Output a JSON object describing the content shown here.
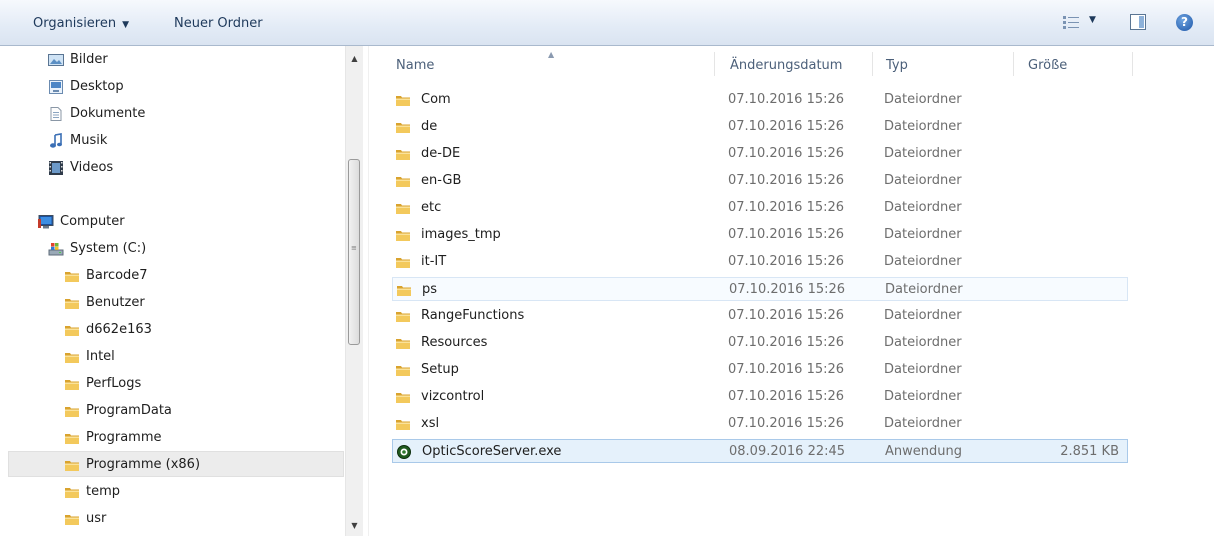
{
  "toolbar": {
    "organize_label": "Organisieren",
    "new_folder_label": "Neuer Ordner",
    "help_glyph": "?"
  },
  "nav": {
    "items": [
      {
        "label": "Bilder",
        "icon": "pictures-icon"
      },
      {
        "label": "Desktop",
        "icon": "desktop-icon"
      },
      {
        "label": "Dokumente",
        "icon": "documents-icon"
      },
      {
        "label": "Musik",
        "icon": "music-icon"
      },
      {
        "label": "Videos",
        "icon": "videos-icon"
      },
      {
        "label": "Computer",
        "icon": "computer-icon"
      },
      {
        "label": "System (C:)",
        "icon": "drive-icon"
      },
      {
        "label": "Barcode7",
        "icon": "folder-icon"
      },
      {
        "label": "Benutzer",
        "icon": "folder-icon"
      },
      {
        "label": "d662e163",
        "icon": "folder-icon"
      },
      {
        "label": "Intel",
        "icon": "folder-icon"
      },
      {
        "label": "PerfLogs",
        "icon": "folder-icon"
      },
      {
        "label": "ProgramData",
        "icon": "folder-icon"
      },
      {
        "label": "Programme",
        "icon": "folder-icon"
      },
      {
        "label": "Programme (x86)",
        "icon": "folder-icon"
      },
      {
        "label": "temp",
        "icon": "folder-icon"
      },
      {
        "label": "usr",
        "icon": "folder-icon"
      }
    ]
  },
  "columns": {
    "name": "Name",
    "date": "Änderungsdatum",
    "type": "Typ",
    "size": "Größe"
  },
  "files": [
    {
      "name": "Com",
      "date": "07.10.2016 15:26",
      "type": "Dateiordner",
      "size": ""
    },
    {
      "name": "de",
      "date": "07.10.2016 15:26",
      "type": "Dateiordner",
      "size": ""
    },
    {
      "name": "de-DE",
      "date": "07.10.2016 15:26",
      "type": "Dateiordner",
      "size": ""
    },
    {
      "name": "en-GB",
      "date": "07.10.2016 15:26",
      "type": "Dateiordner",
      "size": ""
    },
    {
      "name": "etc",
      "date": "07.10.2016 15:26",
      "type": "Dateiordner",
      "size": ""
    },
    {
      "name": "images_tmp",
      "date": "07.10.2016 15:26",
      "type": "Dateiordner",
      "size": ""
    },
    {
      "name": "it-IT",
      "date": "07.10.2016 15:26",
      "type": "Dateiordner",
      "size": ""
    },
    {
      "name": "ps",
      "date": "07.10.2016 15:26",
      "type": "Dateiordner",
      "size": ""
    },
    {
      "name": "RangeFunctions",
      "date": "07.10.2016 15:26",
      "type": "Dateiordner",
      "size": ""
    },
    {
      "name": "Resources",
      "date": "07.10.2016 15:26",
      "type": "Dateiordner",
      "size": ""
    },
    {
      "name": "Setup",
      "date": "07.10.2016 15:26",
      "type": "Dateiordner",
      "size": ""
    },
    {
      "name": "vizcontrol",
      "date": "07.10.2016 15:26",
      "type": "Dateiordner",
      "size": ""
    },
    {
      "name": "xsl",
      "date": "07.10.2016 15:26",
      "type": "Dateiordner",
      "size": ""
    },
    {
      "name": "OpticScoreServer.exe",
      "date": "08.09.2016 22:45",
      "type": "Anwendung",
      "size": "2.851 KB"
    }
  ],
  "colors": {
    "folder": "#e8b339",
    "selection": "#e5f1fb",
    "toolbar_text": "#1e395b"
  }
}
